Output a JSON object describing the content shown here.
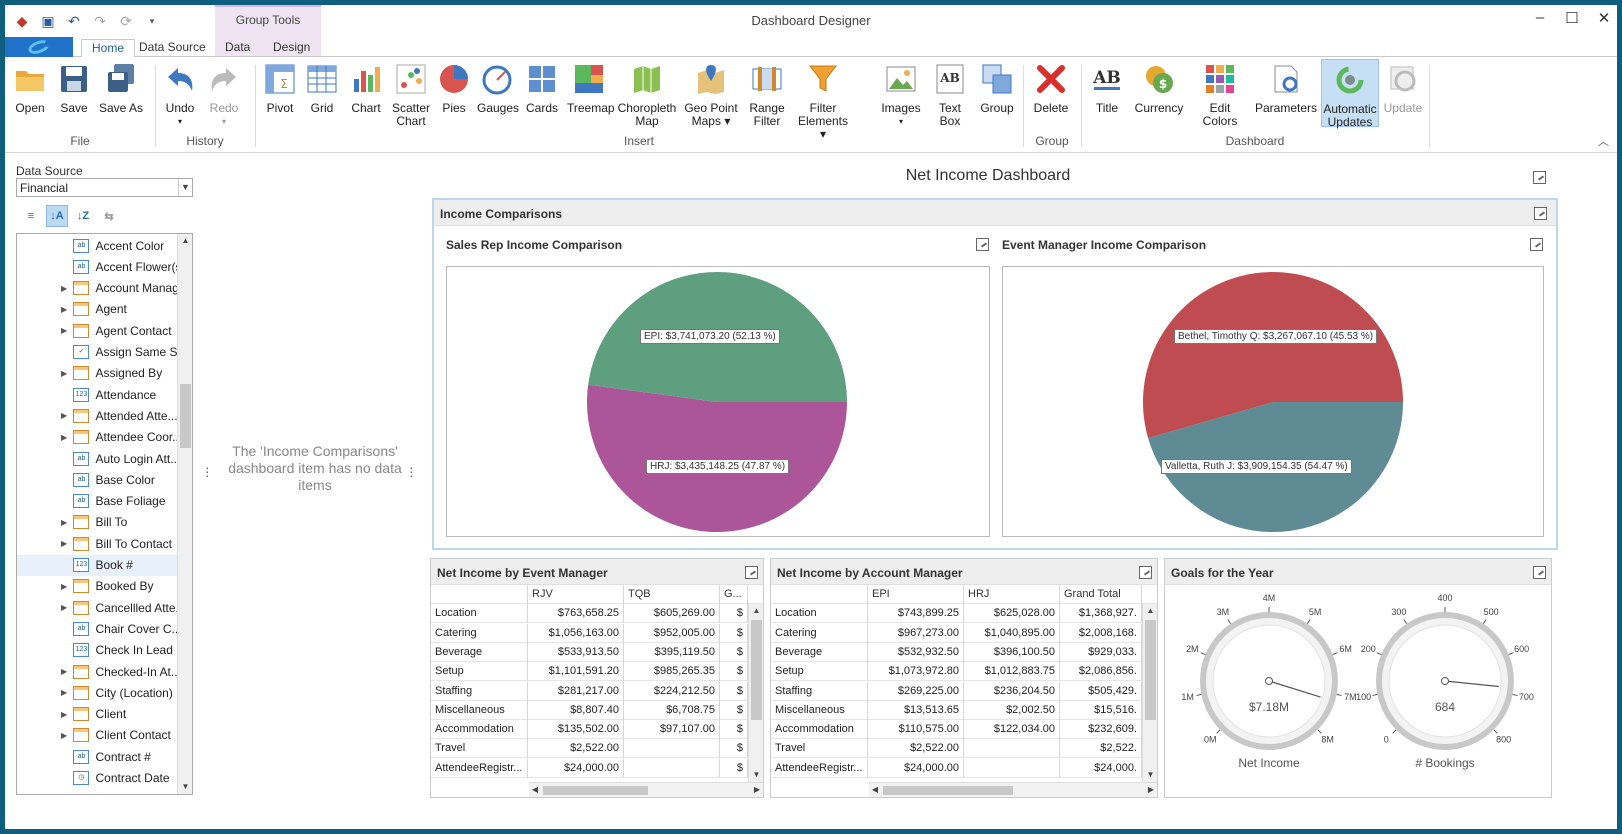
{
  "window": {
    "title": "Dashboard Designer",
    "context_group": "Group Tools"
  },
  "ribbon_tabs": [
    "Home",
    "Data Source",
    "Data",
    "Design"
  ],
  "ribbon": {
    "file": {
      "label": "File",
      "open": "Open",
      "save": "Save",
      "save_as": "Save As"
    },
    "history": {
      "label": "History",
      "undo": "Undo",
      "redo": "Redo"
    },
    "insert": {
      "label": "Insert",
      "pivot": "Pivot",
      "grid": "Grid",
      "chart": "Chart",
      "scatter_1": "Scatter",
      "scatter_2": "Chart",
      "pies": "Pies",
      "gauges": "Gauges",
      "cards": "Cards",
      "treemap": "Treemap",
      "choropleth_1": "Choropleth",
      "choropleth_2": "Map",
      "geo_1": "Geo Point",
      "geo_2": "Maps",
      "range_1": "Range",
      "range_2": "Filter",
      "filter_1": "Filter",
      "filter_2": "Elements",
      "images": "Images",
      "textbox": "Text Box",
      "group": "Group"
    },
    "group_grp": {
      "label": "Group",
      "delete": "Delete"
    },
    "dashboard": {
      "label": "Dashboard",
      "title": "Title",
      "currency": "Currency",
      "edit_colors": "Edit Colors",
      "parameters": "Parameters",
      "auto_1": "Automatic",
      "auto_2": "Updates",
      "update": "Update"
    }
  },
  "data_source": {
    "label": "Data Source",
    "selected": "Financial",
    "fields": [
      {
        "name": "Accent Color",
        "type": "ab",
        "expandable": false
      },
      {
        "name": "Accent Flower(s)",
        "type": "ab",
        "expandable": false
      },
      {
        "name": "Account Manager",
        "type": "tbl",
        "expandable": true
      },
      {
        "name": "Agent",
        "type": "tbl",
        "expandable": true
      },
      {
        "name": "Agent Contact",
        "type": "tbl",
        "expandable": true
      },
      {
        "name": "Assign Same S...",
        "type": "chk",
        "expandable": false
      },
      {
        "name": "Assigned By",
        "type": "tbl",
        "expandable": true
      },
      {
        "name": "Attendance",
        "type": "123",
        "expandable": false
      },
      {
        "name": "Attended Atte...",
        "type": "tbl",
        "expandable": true
      },
      {
        "name": "Attendee Coor...",
        "type": "tbl",
        "expandable": true
      },
      {
        "name": "Auto Login Att...",
        "type": "ab",
        "expandable": false
      },
      {
        "name": "Base Color",
        "type": "ab",
        "expandable": false
      },
      {
        "name": "Base Foliage",
        "type": "ab",
        "expandable": false
      },
      {
        "name": "Bill To",
        "type": "tbl",
        "expandable": true
      },
      {
        "name": "Bill To Contact",
        "type": "tbl",
        "expandable": true
      },
      {
        "name": "Book #",
        "type": "123",
        "expandable": false,
        "selected": true
      },
      {
        "name": "Booked By",
        "type": "tbl",
        "expandable": true
      },
      {
        "name": "Cancellled Atte...",
        "type": "tbl",
        "expandable": true
      },
      {
        "name": "Chair Cover C...",
        "type": "ab",
        "expandable": false
      },
      {
        "name": "Check In Lead ...",
        "type": "123",
        "expandable": false
      },
      {
        "name": "Checked-In At...",
        "type": "tbl",
        "expandable": true
      },
      {
        "name": "City (Location)",
        "type": "tbl",
        "expandable": true
      },
      {
        "name": "Client",
        "type": "tbl",
        "expandable": true
      },
      {
        "name": "Client Contact",
        "type": "tbl",
        "expandable": true
      },
      {
        "name": "Contract #",
        "type": "ab",
        "expandable": false
      },
      {
        "name": "Contract Date",
        "type": "clk",
        "expandable": false
      }
    ]
  },
  "middle": {
    "no_data": "The 'Income Comparisons' dashboard item has no data items"
  },
  "dashboard": {
    "title": "Net Income Dashboard",
    "group_title": "Income Comparisons",
    "pie_left": {
      "title": "Sales Rep Income Comparison",
      "slices": [
        {
          "label": "EPI: $3,741,073.20 (52.13 %)",
          "value": 52.13,
          "color": "#ac5699"
        },
        {
          "label": "HRJ: $3,435,148.25 (47.87 %)",
          "value": 47.87,
          "color": "#5e9f7f"
        }
      ]
    },
    "pie_right": {
      "title": "Event Manager Income Comparison",
      "slices": [
        {
          "label": "Bethel, Timothy Q: $3,267,067.10 (45.53 %)",
          "value": 45.53,
          "color": "#5f8c94"
        },
        {
          "label": "Valletta, Ruth J: $3,909,154.35 (54.47 %)",
          "value": 54.47,
          "color": "#bf4c50"
        }
      ]
    },
    "grid_event": {
      "title": "Net Income by Event Manager",
      "columns": [
        "",
        "RJV",
        "TQB",
        "G..."
      ],
      "rows": [
        [
          "Location",
          "$763,658.25",
          "$605,269.00",
          "$"
        ],
        [
          "Catering",
          "$1,056,163.00",
          "$952,005.00",
          "$"
        ],
        [
          "Beverage",
          "$533,913.50",
          "$395,119.50",
          "$"
        ],
        [
          "Setup",
          "$1,101,591.20",
          "$985,265.35",
          "$"
        ],
        [
          "Staffing",
          "$281,217.00",
          "$224,212.50",
          "$"
        ],
        [
          "Miscellaneous",
          "$8,807.40",
          "$6,708.75",
          "$"
        ],
        [
          "Accommodation",
          "$135,502.00",
          "$97,107.00",
          "$"
        ],
        [
          "Travel",
          "$2,522.00",
          "",
          "$"
        ],
        [
          "AttendeeRegistr...",
          "$24,000.00",
          "",
          "$"
        ]
      ]
    },
    "grid_account": {
      "title": "Net Income by Account Manager",
      "columns": [
        "",
        "EPI",
        "HRJ",
        "Grand Total"
      ],
      "rows": [
        [
          "Location",
          "$743,899.25",
          "$625,028.00",
          "$1,368,927."
        ],
        [
          "Catering",
          "$967,273.00",
          "$1,040,895.00",
          "$2,008,168."
        ],
        [
          "Beverage",
          "$532,932.50",
          "$396,100.50",
          "$929,033."
        ],
        [
          "Setup",
          "$1,073,972.80",
          "$1,012,883.75",
          "$2,086,856."
        ],
        [
          "Staffing",
          "$269,225.00",
          "$236,204.50",
          "$505,429."
        ],
        [
          "Miscellaneous",
          "$13,513.65",
          "$2,002.50",
          "$15,516."
        ],
        [
          "Accommodation",
          "$110,575.00",
          "$122,034.00",
          "$232,609."
        ],
        [
          "Travel",
          "$2,522.00",
          "",
          "$2,522."
        ],
        [
          "AttendeeRegistr...",
          "$24,000.00",
          "",
          "$24,000."
        ]
      ]
    },
    "goals": {
      "title": "Goals for the Year",
      "gauges": [
        {
          "name": "Net Income",
          "value_text": "$7.18M",
          "value": 7.18,
          "min": 0,
          "max": 8,
          "ticks": [
            "0M",
            "1M",
            "2M",
            "3M",
            "4M",
            "5M",
            "6M",
            "7M",
            "8M"
          ]
        },
        {
          "name": "#  Bookings",
          "value_text": "684",
          "value": 684,
          "min": 0,
          "max": 800,
          "ticks": [
            "0",
            "100",
            "200",
            "300",
            "400",
            "500",
            "600",
            "700",
            "800"
          ]
        }
      ]
    }
  }
}
